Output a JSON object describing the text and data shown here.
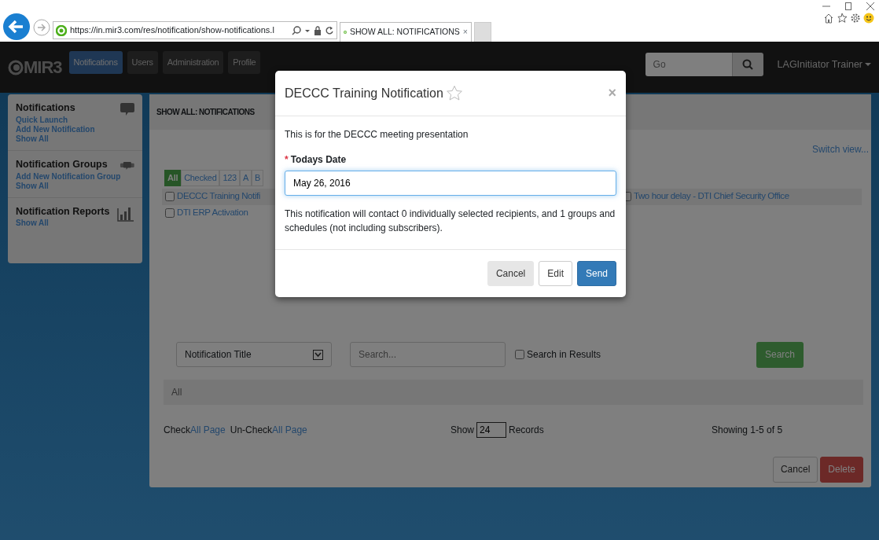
{
  "browser": {
    "url": "https://in.mir3.com/res/notification/show-notifications.l",
    "tab": {
      "title": "SHOW ALL: NOTIFICATIONS",
      "close": "×"
    }
  },
  "navbar": {
    "logo": "MIR3",
    "tabs": [
      {
        "label": "Notifications",
        "selected": true
      },
      {
        "label": "Users",
        "selected": false
      },
      {
        "label": "Administration",
        "selected": false
      },
      {
        "label": "Profile",
        "selected": false
      }
    ],
    "search": {
      "placeholder": "Go"
    },
    "user": "LAGInitiator Trainer"
  },
  "sidebar": {
    "sections": [
      {
        "title": "Notifications",
        "kind": "chat",
        "links": [
          "Quick Launch",
          "Add New Notification",
          "Show All"
        ]
      },
      {
        "title": "Notification Groups",
        "kind": "group",
        "links": [
          "Add New Notification Group",
          "Show All"
        ]
      },
      {
        "title": "Notification Reports",
        "kind": "chart",
        "links": [
          "Show All"
        ]
      }
    ]
  },
  "main": {
    "header": "SHOW ALL: NOTIFICATIONS",
    "switch_view": "Switch view...",
    "filters": [
      {
        "label": "All",
        "selected": true
      },
      {
        "label": "Checked",
        "selected": false
      },
      {
        "label": "123",
        "selected": false
      },
      {
        "label": "A",
        "selected": false
      },
      {
        "label": "B",
        "selected": false
      }
    ],
    "rows": [
      {
        "cells": [
          {
            "title": "DECCC Training Notifi",
            "checked": false
          },
          {
            "title": "Two hour delay - DTI Chief Security Office",
            "checked": false
          }
        ]
      },
      {
        "cells": [
          {
            "title": "DTI ERP Activation",
            "checked": false
          }
        ]
      }
    ],
    "search": {
      "field_select": "Notification Title",
      "placeholder": "Search...",
      "in_results": {
        "label": "Search in Results",
        "checked": false
      },
      "button": "Search"
    },
    "breadcrumb": "All",
    "paging": {
      "check": "Check",
      "check_link": "All Page",
      "uncheck": "Un-Check",
      "uncheck_link": "All Page",
      "show": "Show",
      "records_value": "24",
      "records": "Records",
      "showing": "Showing 1-5 of 5"
    },
    "actions": [
      {
        "label": "Cancel",
        "kind": "default"
      },
      {
        "label": "Delete",
        "kind": "danger"
      }
    ]
  },
  "modal": {
    "title": "DECCC Training Notification",
    "starred": false,
    "close": "×",
    "intro": "This is for the DECCC meeting presentation",
    "field": {
      "required_mark": "*",
      "label": "Todays Date",
      "value": "May 26, 2016"
    },
    "message": "This notification will contact 0 individually selected recipients, and 1 groups and schedules (not including subscribers).",
    "buttons": [
      {
        "label": "Cancel",
        "kind": "secondary"
      },
      {
        "label": "Edit",
        "kind": "default"
      },
      {
        "label": "Send",
        "kind": "primary"
      }
    ]
  }
}
